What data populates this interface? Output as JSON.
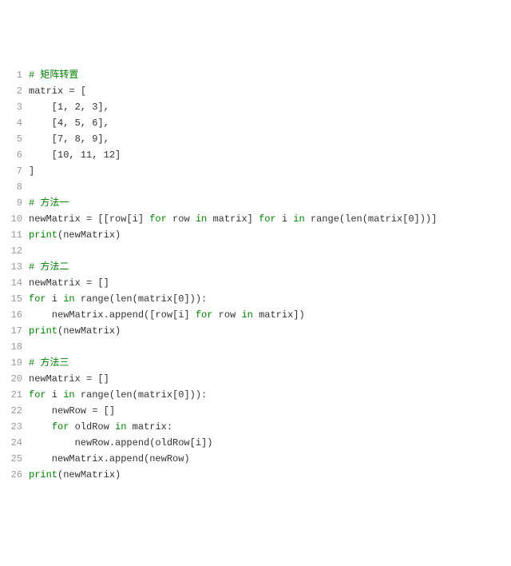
{
  "lines": [
    {
      "n": 1,
      "tokens": [
        [
          "cm",
          "# 矩阵转置"
        ]
      ]
    },
    {
      "n": 2,
      "tokens": [
        [
          "id",
          "matrix "
        ],
        [
          "id",
          "= ["
        ]
      ]
    },
    {
      "n": 3,
      "tokens": [
        [
          "id",
          "    [1, 2, 3],"
        ]
      ]
    },
    {
      "n": 4,
      "tokens": [
        [
          "id",
          "    [4, 5, 6],"
        ]
      ]
    },
    {
      "n": 5,
      "tokens": [
        [
          "id",
          "    [7, 8, 9],"
        ]
      ]
    },
    {
      "n": 6,
      "tokens": [
        [
          "id",
          "    [10, 11, 12]"
        ]
      ]
    },
    {
      "n": 7,
      "tokens": [
        [
          "id",
          "]"
        ]
      ]
    },
    {
      "n": 8,
      "tokens": [
        [
          "id",
          ""
        ]
      ]
    },
    {
      "n": 9,
      "tokens": [
        [
          "cm",
          "# 方法一"
        ]
      ]
    },
    {
      "n": 10,
      "tokens": [
        [
          "id",
          "newMatrix = [[row[i] "
        ],
        [
          "kw",
          "for"
        ],
        [
          "id",
          " row "
        ],
        [
          "kw",
          "in"
        ],
        [
          "id",
          " matrix] "
        ],
        [
          "kw",
          "for"
        ],
        [
          "id",
          " i "
        ],
        [
          "kw",
          "in"
        ],
        [
          "id",
          " range(len(matrix[0]))]"
        ]
      ]
    },
    {
      "n": 11,
      "tokens": [
        [
          "kw",
          "print"
        ],
        [
          "id",
          "(newMatrix)"
        ]
      ]
    },
    {
      "n": 12,
      "tokens": [
        [
          "id",
          ""
        ]
      ]
    },
    {
      "n": 13,
      "tokens": [
        [
          "cm",
          "# 方法二"
        ]
      ]
    },
    {
      "n": 14,
      "tokens": [
        [
          "id",
          "newMatrix = []"
        ]
      ]
    },
    {
      "n": 15,
      "tokens": [
        [
          "kw",
          "for"
        ],
        [
          "id",
          " i "
        ],
        [
          "kw",
          "in"
        ],
        [
          "id",
          " range(len(matrix[0])):"
        ]
      ]
    },
    {
      "n": 16,
      "tokens": [
        [
          "id",
          "    newMatrix.append([row[i] "
        ],
        [
          "kw",
          "for"
        ],
        [
          "id",
          " row "
        ],
        [
          "kw",
          "in"
        ],
        [
          "id",
          " matrix])"
        ]
      ]
    },
    {
      "n": 17,
      "tokens": [
        [
          "kw",
          "print"
        ],
        [
          "id",
          "(newMatrix)"
        ]
      ]
    },
    {
      "n": 18,
      "tokens": [
        [
          "id",
          ""
        ]
      ]
    },
    {
      "n": 19,
      "tokens": [
        [
          "cm",
          "# 方法三"
        ]
      ]
    },
    {
      "n": 20,
      "tokens": [
        [
          "id",
          "newMatrix = []"
        ]
      ]
    },
    {
      "n": 21,
      "tokens": [
        [
          "kw",
          "for"
        ],
        [
          "id",
          " i "
        ],
        [
          "kw",
          "in"
        ],
        [
          "id",
          " range(len(matrix[0])):"
        ]
      ]
    },
    {
      "n": 22,
      "tokens": [
        [
          "id",
          "    newRow = []"
        ]
      ]
    },
    {
      "n": 23,
      "tokens": [
        [
          "id",
          "    "
        ],
        [
          "kw",
          "for"
        ],
        [
          "id",
          " oldRow "
        ],
        [
          "kw",
          "in"
        ],
        [
          "id",
          " matrix:"
        ]
      ]
    },
    {
      "n": 24,
      "tokens": [
        [
          "id",
          "        newRow.append(oldRow[i])"
        ]
      ]
    },
    {
      "n": 25,
      "tokens": [
        [
          "id",
          "    newMatrix.append(newRow)"
        ]
      ]
    },
    {
      "n": 26,
      "tokens": [
        [
          "kw",
          "print"
        ],
        [
          "id",
          "(newMatrix)"
        ]
      ]
    }
  ]
}
